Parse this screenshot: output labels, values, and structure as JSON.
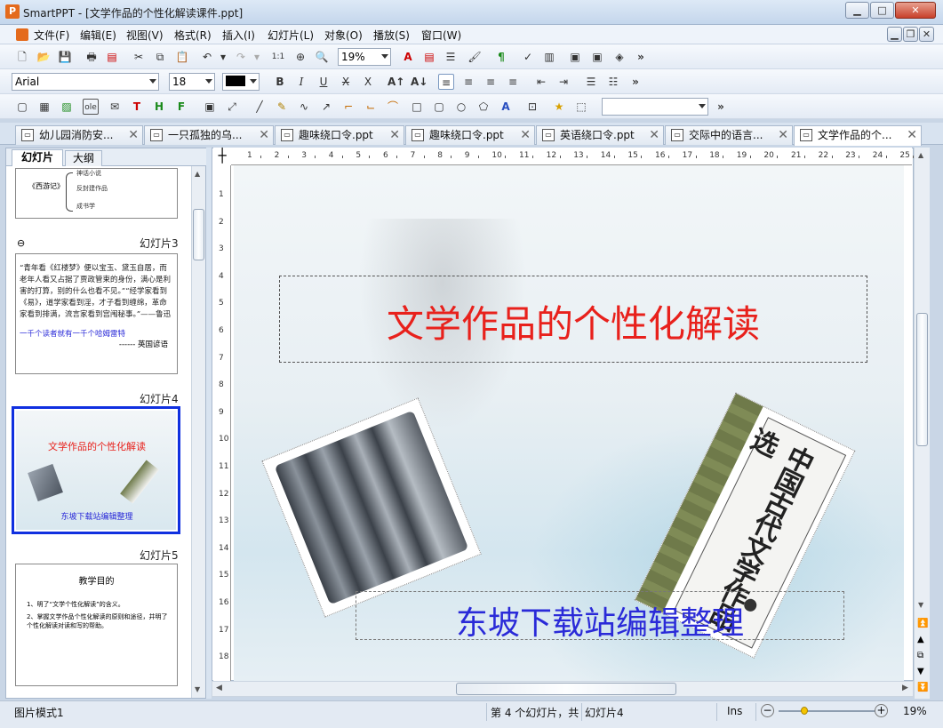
{
  "window": {
    "title": "SmartPPT - [文学作品的个性化解读课件.ppt]",
    "app_icon": "P",
    "minimize": "▁",
    "maximize": "□",
    "close": "✕"
  },
  "menu": [
    "文件(F)",
    "编辑(E)",
    "视图(V)",
    "格式(R)",
    "插入(I)",
    "幻灯片(L)",
    "对象(O)",
    "播放(S)",
    "窗口(W)"
  ],
  "mdi": {
    "minimize": "▁",
    "restore": "❐",
    "close": "✕"
  },
  "toolbar1": {
    "zoom": "19%",
    "more": "»"
  },
  "toolbar2": {
    "font": "Arial",
    "size": "18",
    "bold": "B",
    "italic": "I",
    "underline": "U",
    "strike": "X",
    "clear": "X",
    "more": "»"
  },
  "toolbar3": {
    "ole": "ole",
    "more": "»"
  },
  "tabs": [
    {
      "label": "幼儿园消防安..."
    },
    {
      "label": "一只孤独的乌..."
    },
    {
      "label": "趣味绕口令.ppt"
    },
    {
      "label": "趣味绕口令.ppt"
    },
    {
      "label": "英语绕口令.ppt"
    },
    {
      "label": "交际中的语言..."
    },
    {
      "label": "文学作品的个..."
    }
  ],
  "left_panel": {
    "tabs": [
      "幻灯片",
      "大纲"
    ],
    "slide2": {
      "lines": [
        "神话小说",
        "反封建作品",
        "成书学"
      ],
      "book": "《西游记》"
    },
    "slide3": {
      "label": "幻灯片3",
      "text": "“青年看《红楼梦》便以宝玉、黛玉自居，而老年人看又占据了贾政管束的身份，满心是利害的打算，别的什么也看不见。”“经学家看到《易》，道学家看到淫，才子看到缠绵，革命家看到排满，流言家看到宫闱秘事。”——鲁迅",
      "quote": "一千个读者就有一千个哈姆雷特",
      "source": "------ 英国谚语"
    },
    "slide4": {
      "label": "幻灯片4",
      "title": "文学作品的个性化解读",
      "subtitle": "东坡下载站编辑整理"
    },
    "slide5": {
      "label": "幻灯片5",
      "title": "教学目的",
      "items": [
        "1、明了“文学个性化解读”的含义。",
        "2、掌握文学作品个性化解读的原则和途径，并明了个性化解读对读和写的帮助。"
      ]
    }
  },
  "ruler": {
    "h": [
      "1",
      "2",
      "3",
      "4",
      "5",
      "6",
      "7",
      "8",
      "9",
      "10",
      "11",
      "12",
      "13",
      "14",
      "15",
      "16",
      "17",
      "18",
      "19",
      "20",
      "21",
      "22",
      "23",
      "24",
      "25"
    ],
    "v": [
      "1",
      "2",
      "3",
      "4",
      "5",
      "6",
      "7",
      "8",
      "9",
      "10",
      "11",
      "12",
      "13",
      "14",
      "15",
      "16",
      "17",
      "18"
    ]
  },
  "slide": {
    "title": "文学作品的个性化解读",
    "subtitle": "东坡下载站编辑整理",
    "book_title": "中国古代文学作品选"
  },
  "colors": {
    "title": "#e8211c",
    "subtitle": "#2a2ad8",
    "selection": "#1030e0"
  },
  "status": {
    "mode": "图片模式1",
    "slide_info": "第 4 个幻灯片，共",
    "slide_name": "幻灯片4",
    "ins": "Ins",
    "zoom": "19%",
    "zoom_out": "−",
    "zoom_in": "+"
  }
}
